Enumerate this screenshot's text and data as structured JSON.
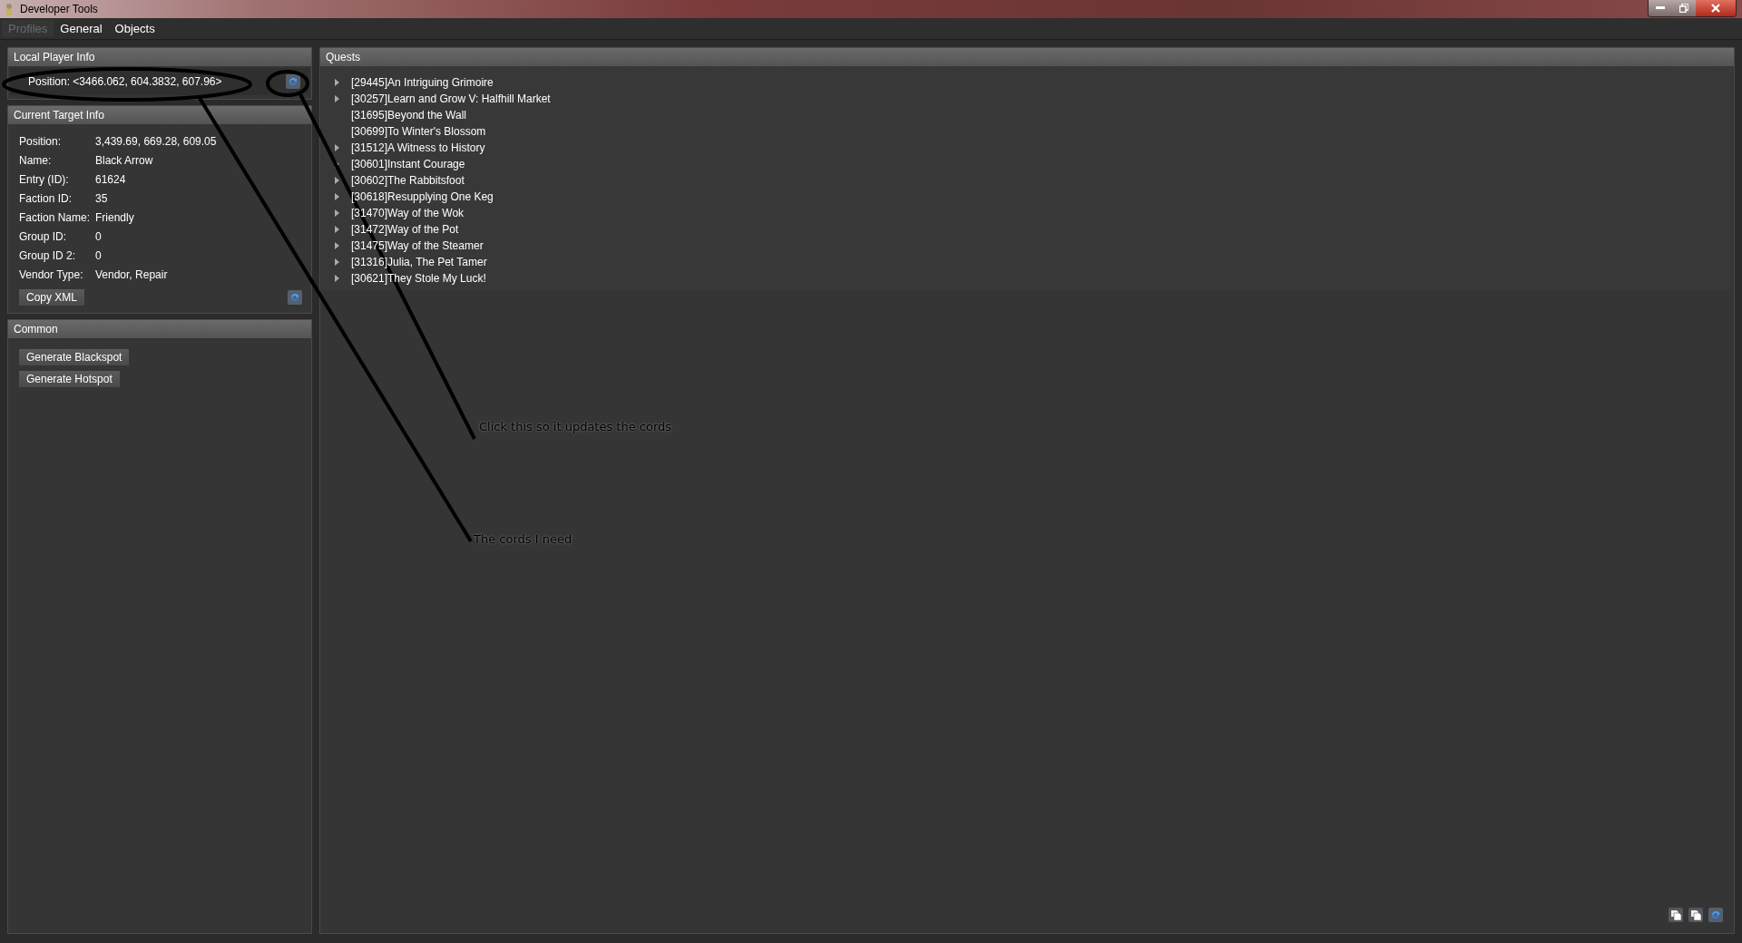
{
  "window": {
    "title": "Developer Tools"
  },
  "tabs": [
    {
      "label": "Profiles",
      "disabled": true
    },
    {
      "label": "General",
      "disabled": false
    },
    {
      "label": "Objects",
      "disabled": false
    }
  ],
  "local_player_info": {
    "title": "Local Player Info",
    "position": "Position: <3466.062, 604.3832, 607.96>"
  },
  "current_target_info": {
    "title": "Current Target Info",
    "fields": [
      {
        "label": "Position:",
        "value": "3,439.69, 669.28, 609.05"
      },
      {
        "label": "Name:",
        "value": "Black Arrow"
      },
      {
        "label": "Entry (ID):",
        "value": "61624"
      },
      {
        "label": "Faction ID:",
        "value": "35"
      },
      {
        "label": "Faction Name:",
        "value": "Friendly"
      },
      {
        "label": "Group ID:",
        "value": "0"
      },
      {
        "label": "Group ID 2:",
        "value": "0"
      },
      {
        "label": "Vendor Type:",
        "value": "Vendor, Repair"
      }
    ],
    "button": "Copy XML"
  },
  "common": {
    "title": "Common",
    "buttons": [
      "Generate Blackspot",
      "Generate Hotspot"
    ]
  },
  "quests": {
    "title": "Quests",
    "items": [
      {
        "label": "[29445]An Intriguing Grimoire",
        "expandable": true
      },
      {
        "label": "[30257]Learn and Grow V: Halfhill Market",
        "expandable": true
      },
      {
        "label": "[31695]Beyond the Wall",
        "expandable": false
      },
      {
        "label": "[30699]To Winter's Blossom",
        "expandable": false
      },
      {
        "label": "[31512]A Witness to History",
        "expandable": true
      },
      {
        "label": "[30601]Instant Courage",
        "expandable": true
      },
      {
        "label": "[30602]The Rabbitsfoot",
        "expandable": true
      },
      {
        "label": "[30618]Resupplying One Keg",
        "expandable": true
      },
      {
        "label": "[31470]Way of the Wok",
        "expandable": true
      },
      {
        "label": "[31472]Way of the Pot",
        "expandable": true
      },
      {
        "label": "[31475]Way of the Steamer",
        "expandable": true
      },
      {
        "label": "[31316]Julia, The Pet Tamer",
        "expandable": true
      },
      {
        "label": "[30621]They Stole My Luck!",
        "expandable": true
      }
    ]
  },
  "annotations": [
    {
      "text": "Click this so it updates the cords"
    },
    {
      "text": "The cords I need"
    }
  ]
}
